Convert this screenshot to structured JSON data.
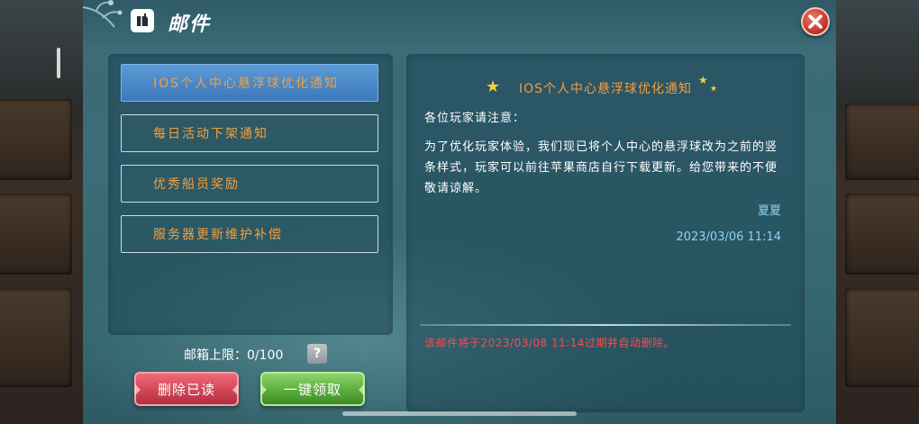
{
  "window": {
    "title": "邮件"
  },
  "mail_list": {
    "items": [
      {
        "label": "IOS个人中心悬浮球优化通知",
        "selected": true
      },
      {
        "label": "每日活动下架通知",
        "selected": false
      },
      {
        "label": "优秀船员奖励",
        "selected": false
      },
      {
        "label": "服务器更新维护补偿",
        "selected": false
      }
    ]
  },
  "mailbox": {
    "capacity_label": "邮箱上限：0/100",
    "help_label": "?"
  },
  "buttons": {
    "delete_read": "删除已读",
    "claim_all": "一键领取"
  },
  "mail_detail": {
    "title": "IOS个人中心悬浮球优化通知",
    "greeting": "各位玩家请注意：",
    "body": "为了优化玩家体验，我们现已将个人中心的悬浮球改为之前的竖条样式，玩家可以前往苹果商店自行下载更新。给您带来的不便敬请谅解。",
    "sender": "夏夏",
    "date": "2023/03/06 11:14",
    "expiry_notice": "该邮件将于2023/03/08 11:14过期并自动删除。"
  },
  "icons": {
    "mail": "mail-icon",
    "close": "close-icon",
    "star": "star-icon"
  },
  "colors": {
    "accent_orange": "#f0a040",
    "selected_blue": "#4a88c8",
    "date_blue": "#8fd3f0",
    "warning_red": "#ff4a4a",
    "delete_red": "#d24657",
    "claim_green": "#5aae3c"
  }
}
